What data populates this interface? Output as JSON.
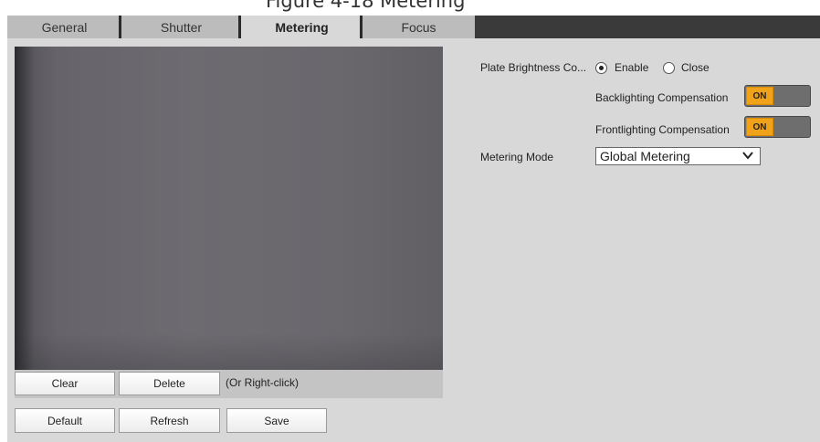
{
  "header": {
    "partial_caption": "Figure 4-18 Metering"
  },
  "tabs": [
    {
      "label": "General"
    },
    {
      "label": "Shutter"
    },
    {
      "label": "Metering"
    },
    {
      "label": "Focus"
    }
  ],
  "active_tab": "Metering",
  "preview_toolbar": {
    "clear_label": "Clear",
    "delete_label": "Delete",
    "hint": "(Or Right-click)"
  },
  "footer": {
    "default_label": "Default",
    "refresh_label": "Refresh",
    "save_label": "Save"
  },
  "settings": {
    "plate_brightness_label": "Plate Brightness Co...",
    "enable_label": "Enable",
    "close_label": "Close",
    "plate_brightness_value": "Enable",
    "backlighting_label": "Backlighting Compensation",
    "backlighting_state": "ON",
    "frontlighting_label": "Frontlighting Compensation",
    "frontlighting_state": "ON",
    "metering_mode_label": "Metering Mode",
    "metering_mode_value": "Global Metering"
  },
  "colors": {
    "tab_bar": "#3a3a3a",
    "panel": "#d8d8d8",
    "toggle_on": "#f0a21a"
  }
}
